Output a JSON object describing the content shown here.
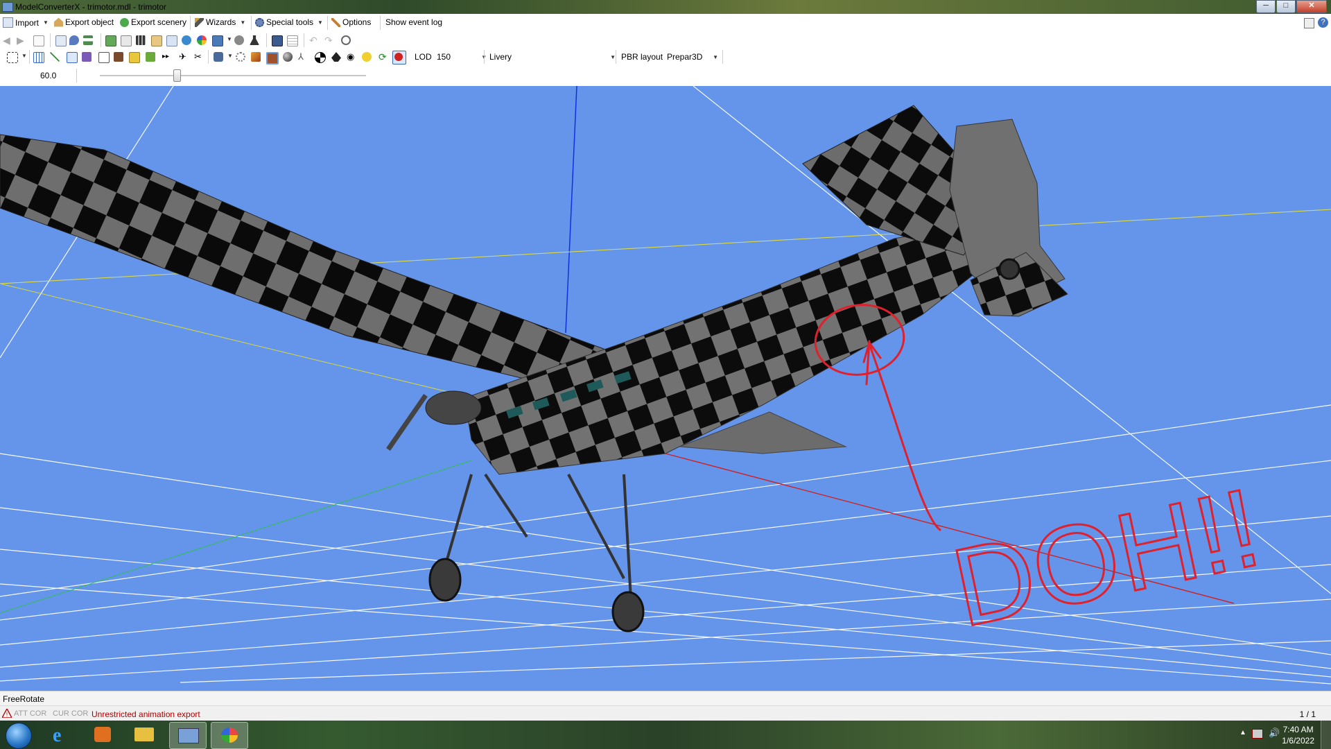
{
  "window": {
    "title": "ModelConverterX - trimotor.mdl - trimotor",
    "buttons": [
      "─",
      "□",
      "✕"
    ]
  },
  "menu": {
    "import": "Import",
    "export_object": "Export object",
    "export_scenery": "Export scenery",
    "wizards": "Wizards",
    "special_tools": "Special tools",
    "options": "Options",
    "show_event_log": "Show event log"
  },
  "toolbar2": {
    "lod_label": "LOD",
    "lod_value": "150",
    "livery_label": "Livery",
    "livery_value": "",
    "pbr_label": "PBR layout",
    "pbr_value": "Prepar3D"
  },
  "toolbar3": {
    "zoom_value": "60.0",
    "slider_position": 0.29
  },
  "viewport": {
    "background": "#6495ea",
    "annotation_text": "DOH!!"
  },
  "status": {
    "mode": "FreeRotate",
    "att_cor": "ATT COR",
    "cur_cor": "CUR COR",
    "warning": "Unrestricted animation export",
    "page": "1 / 1"
  },
  "taskbar": {
    "time": "7:40 AM",
    "date": "1/6/2022"
  },
  "colors": {
    "accent": "#6495ea",
    "warning": "#b00000",
    "annotation": "#e0202a"
  }
}
